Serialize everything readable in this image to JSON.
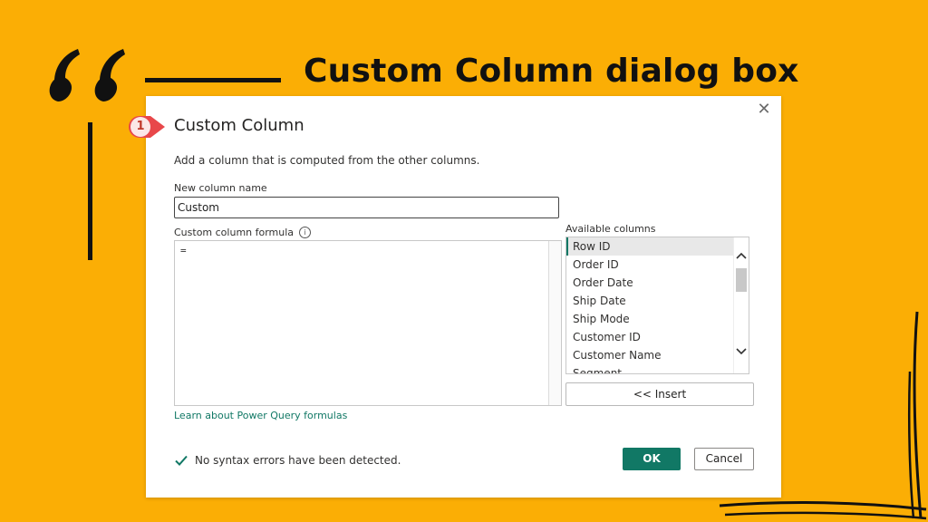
{
  "heading": "Custom Column dialog box",
  "dialog": {
    "title": "Custom Column",
    "step_number": "1",
    "close_symbol": "✕",
    "subtitle": "Add a column that is computed from the other columns.",
    "new_column_label": "New column name",
    "new_column_value": "Custom",
    "formula_label": "Custom column formula",
    "formula_value": "=",
    "available_columns_label": "Available columns",
    "available_columns": [
      "Row ID",
      "Order ID",
      "Order Date",
      "Ship Date",
      "Ship Mode",
      "Customer ID",
      "Customer Name",
      "Segment"
    ],
    "selected_column": "Row ID",
    "insert_label": "<< Insert",
    "learn_link": "Learn about Power Query formulas",
    "status": "No syntax errors have been detected.",
    "ok_label": "OK",
    "cancel_label": "Cancel"
  },
  "colors": {
    "background": "#FBAE05",
    "accent": "#117865",
    "marker": "#E8474A"
  }
}
